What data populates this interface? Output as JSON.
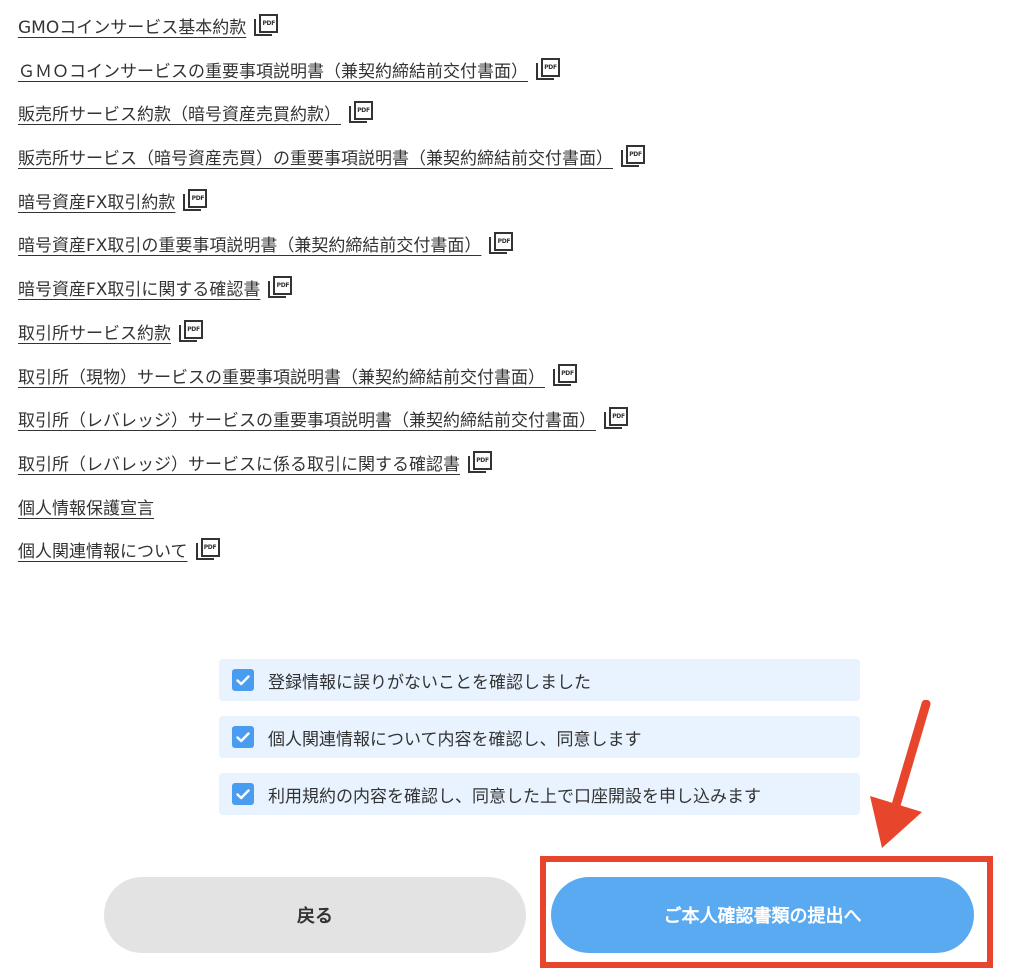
{
  "documents": [
    {
      "label": "GMOコインサービス基本約款",
      "pdf": true
    },
    {
      "label": "ＧＭＯコインサービスの重要事項説明書（兼契約締結前交付書面）",
      "pdf": true
    },
    {
      "label": "販売所サービス約款（暗号資産売買約款）",
      "pdf": true
    },
    {
      "label": "販売所サービス（暗号資産売買）の重要事項説明書（兼契約締結前交付書面）",
      "pdf": true
    },
    {
      "label": "暗号資産FX取引約款",
      "pdf": true
    },
    {
      "label": "暗号資産FX取引の重要事項説明書（兼契約締結前交付書面）",
      "pdf": true
    },
    {
      "label": "暗号資産FX取引に関する確認書",
      "pdf": true
    },
    {
      "label": "取引所サービス約款",
      "pdf": true
    },
    {
      "label": "取引所（現物）サービスの重要事項説明書（兼契約締結前交付書面）",
      "pdf": true
    },
    {
      "label": "取引所（レバレッジ）サービスの重要事項説明書（兼契約締結前交付書面）",
      "pdf": true
    },
    {
      "label": "取引所（レバレッジ）サービスに係る取引に関する確認書",
      "pdf": true
    },
    {
      "label": "個人情報保護宣言",
      "pdf": false
    },
    {
      "label": "個人関連情報について",
      "pdf": true
    }
  ],
  "pdf_icon_text": "PDF",
  "confirmations": [
    {
      "label": "登録情報に誤りがないことを確認しました",
      "checked": true
    },
    {
      "label": "個人関連情報について内容を確認し、同意します",
      "checked": true
    },
    {
      "label": "利用規約の内容を確認し、同意した上で口座開設を申し込みます",
      "checked": true
    }
  ],
  "buttons": {
    "back_label": "戻る",
    "submit_label": "ご本人確認書類の提出へ"
  },
  "colors": {
    "checkbox": "#4a9cf0",
    "check_row_bg": "#e8f3ff",
    "submit_bg": "#5aaaf2",
    "back_bg": "#e3e3e3",
    "highlight": "#e8452d"
  },
  "icons": {
    "pdf": "pdf-icon",
    "check": "check-icon",
    "annotation_arrow": "arrow-icon"
  }
}
